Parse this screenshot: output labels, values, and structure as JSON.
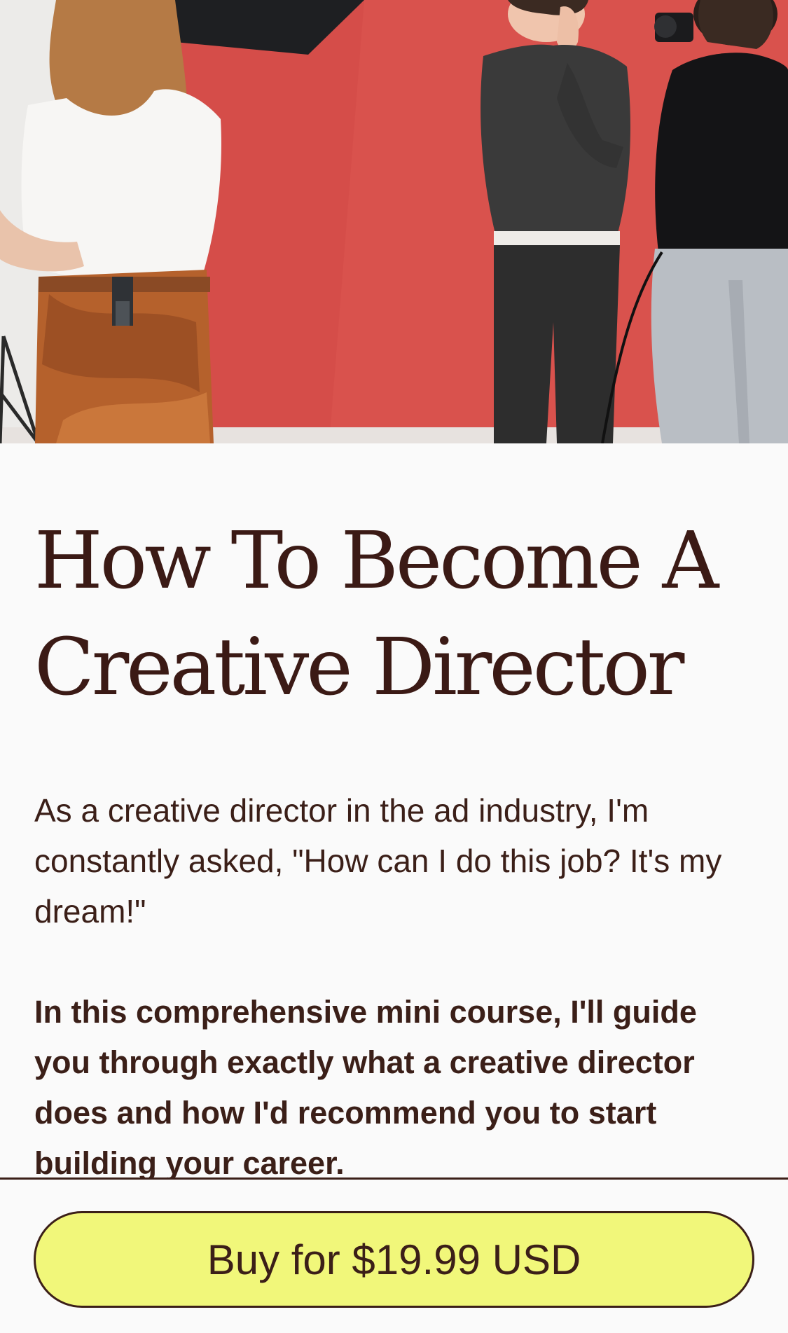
{
  "hero": {
    "image_description": "",
    "colors": {
      "backdrop": "#d9524d",
      "wall": "#ecebe9"
    }
  },
  "product": {
    "title": "How To Become A Creative Director",
    "description": "As a creative director in the ad industry, I'm constantly asked, \"How can I do this job? It's my dream!\"",
    "highlight": "In this comprehensive mini course, I'll guide you through exactly what a creative director does and how I'd recommend you to start building your career."
  },
  "purchase": {
    "button_label": "Buy for $19.99 USD",
    "button_color": "#f1f77a"
  }
}
